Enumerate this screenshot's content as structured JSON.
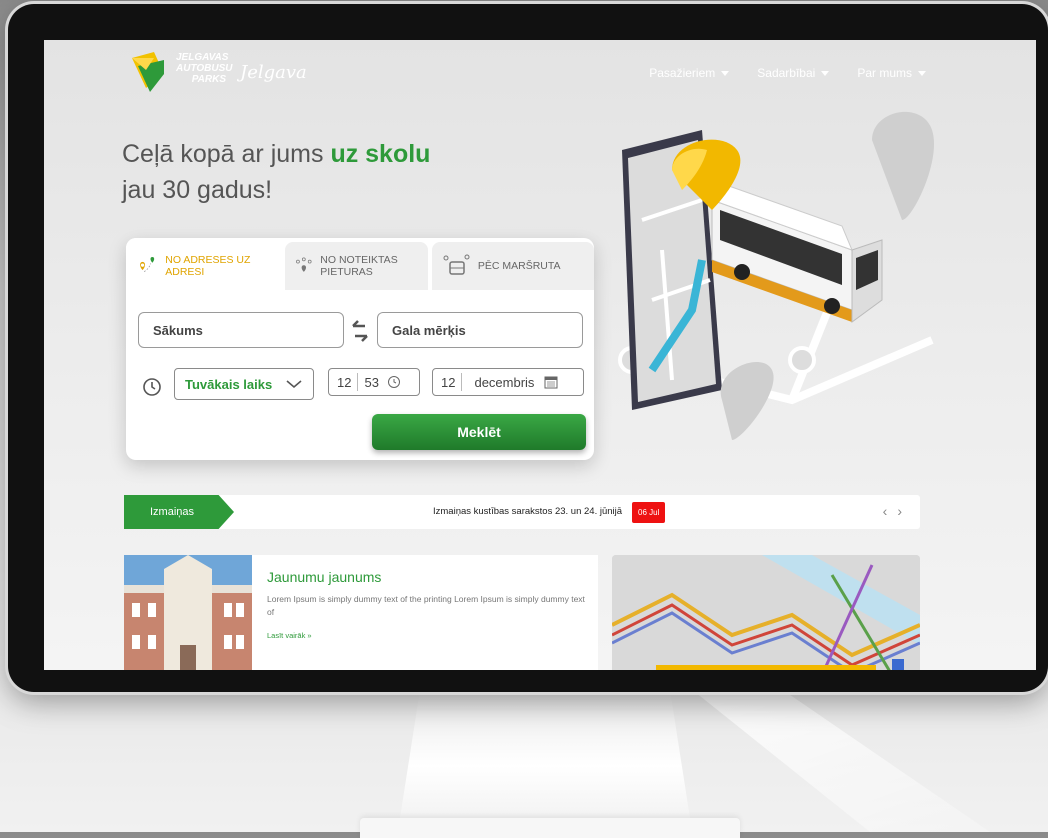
{
  "brand": {
    "logo_text": "JELGAVAS AUTOBUSU PARKS",
    "script_logo": "Jelgava"
  },
  "nav": [
    {
      "label": "Pasažieriem"
    },
    {
      "label": "Sadarbībai"
    },
    {
      "label": "Par mums"
    }
  ],
  "hero": {
    "line1_prefix": "Ceļā kopā ar jums ",
    "line1_accent": "uz skolu",
    "line2": "jau 30 gadus!"
  },
  "search": {
    "tabs": [
      {
        "label": "NO ADRESES UZ ADRESI",
        "active": true
      },
      {
        "label": "NO NOTEIKTAS PIETURAS",
        "active": false
      },
      {
        "label": "PĒC MARŠRUTA",
        "active": false
      }
    ],
    "start_placeholder": "Sākums",
    "destination_placeholder": "Gala mērķis",
    "time_mode": "Tuvākais laiks",
    "hour": "12",
    "minute": "53",
    "day": "12",
    "month": "decembris",
    "button": "Meklēt"
  },
  "ticker": {
    "label": "Izmaiņas",
    "text": "Izmaiņas kustības sarakstos 23. un 24. jūnijā",
    "date": "06 Jul"
  },
  "news": {
    "title": "Jaunumu jaunums",
    "text": "Lorem Ipsum is simply dummy text of the printing Lorem Ipsum is simply dummy text of",
    "more": "Lasīt vairāk »"
  },
  "colors": {
    "accent_green": "#2e9a3a",
    "accent_yellow": "#e0a400",
    "badge_red": "#ee1111"
  }
}
